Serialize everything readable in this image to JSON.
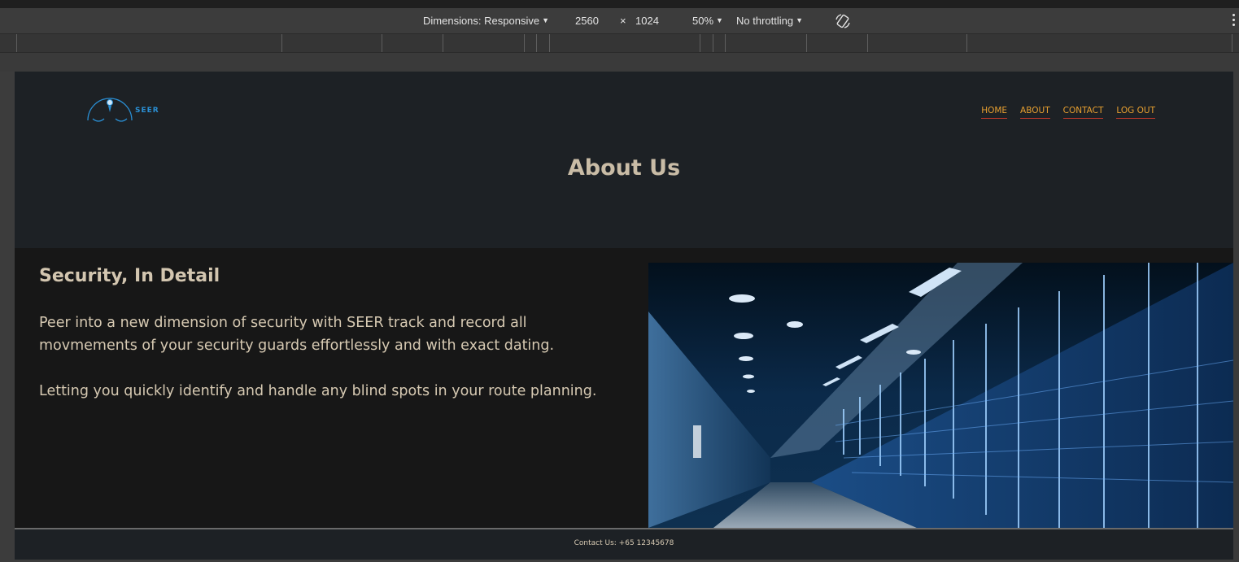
{
  "devtools": {
    "dimensions_label": "Dimensions: Responsive",
    "width": "2560",
    "times": "×",
    "height": "1024",
    "zoom": "50%",
    "throttling": "No throttling",
    "icons": [
      "rotate-icon",
      "more-options-icon"
    ]
  },
  "site": {
    "logo_text": "SEER",
    "nav": [
      "HOME",
      "ABOUT",
      "CONTACT",
      "LOG OUT"
    ],
    "nav_color": "#e8a030",
    "nav_underline_color": "#c0392b",
    "page_title": "About Us",
    "section_heading": "Security, In Detail",
    "paragraphs": [
      "Peer into a new dimension of security with SEER track and record all movmements of your security guards effortlessly and with exact dating.",
      "Letting you quickly identify and handle any blind spots in your route planning."
    ],
    "hero_image": "server-room-photo",
    "footer_text": "Contact Us: +65 12345678"
  }
}
